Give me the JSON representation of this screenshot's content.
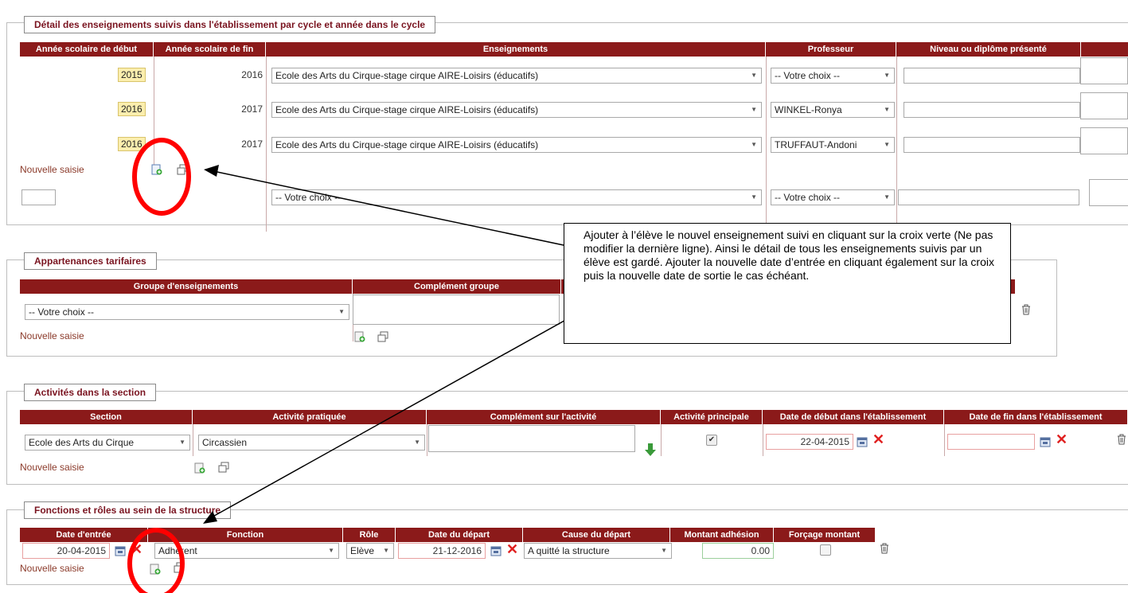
{
  "sec1": {
    "legend": "Détail des enseignements suivis dans l'établissement par cycle et année dans le cycle",
    "headers": [
      "Année scolaire de début",
      "Année scolaire de fin",
      "Enseignements",
      "Professeur",
      "Niveau ou diplôme présenté"
    ],
    "rows": [
      {
        "start": "2015",
        "end": "2016",
        "teaching": "Ecole des Arts du Cirque-stage cirque AIRE-Loisirs (éducatifs)",
        "teacher": "-- Votre choix --"
      },
      {
        "start": "2016",
        "end": "2017",
        "teaching": "Ecole des Arts du Cirque-stage cirque AIRE-Loisirs (éducatifs)",
        "teacher": "WINKEL-Ronya"
      },
      {
        "start": "2016",
        "end": "2017",
        "teaching": "Ecole des Arts du Cirque-stage cirque AIRE-Loisirs (éducatifs)",
        "teacher": "TRUFFAUT-Andoni"
      }
    ],
    "new_entry": "Nouvelle saisie",
    "new_teaching": "-- Votre choix --",
    "new_teacher": "-- Votre choix --"
  },
  "sec2": {
    "legend": "Appartenances tarifaires",
    "headers": [
      "Groupe d'enseignements",
      "Complément groupe"
    ],
    "group": "-- Votre choix --",
    "new_entry": "Nouvelle saisie"
  },
  "sec3": {
    "legend": "Activités dans la section",
    "headers": [
      "Section",
      "Activité pratiquée",
      "Complément sur l'activité",
      "Activité principale",
      "Date de début dans l'établissement",
      "Date de fin dans l'établissement"
    ],
    "section": "Ecole des Arts du Cirque",
    "activity": "Circassien",
    "start_date": "22-04-2015",
    "main_activity_checked": true,
    "new_entry": "Nouvelle saisie"
  },
  "sec4": {
    "legend": "Fonctions et rôles au sein de la structure",
    "headers": [
      "Date d'entrée",
      "Fonction",
      "Rôle",
      "Date du départ",
      "Cause du départ",
      "Montant adhésion",
      "Forçage montant"
    ],
    "entry_date": "20-04-2015",
    "function": "Adhérent",
    "role": "Elève",
    "departure_date": "21-12-2016",
    "departure_cause": "A quitté la structure",
    "amount": "0.00",
    "new_entry": "Nouvelle saisie"
  },
  "callout": {
    "text": "Ajouter à l’élève le nouvel enseignement suivi en cliquant sur la croix verte (Ne pas modifier la dernière ligne). Ainsi le détail de tous les enseignements suivis par un élève est gardé. Ajouter la nouvelle date d’entrée en cliquant également sur la croix puis la nouvelle date de sortie le cas échéant."
  },
  "colors": {
    "header": "#8b1a1a",
    "legend_text": "#7a1420",
    "annotation": "#ff0000",
    "year_highlight": "#fbeeae"
  },
  "icons": [
    "add-entry-icon",
    "duplicate-icon",
    "trash-icon",
    "calendar-icon",
    "clear-date-icon",
    "green-arrow-down-icon"
  ]
}
